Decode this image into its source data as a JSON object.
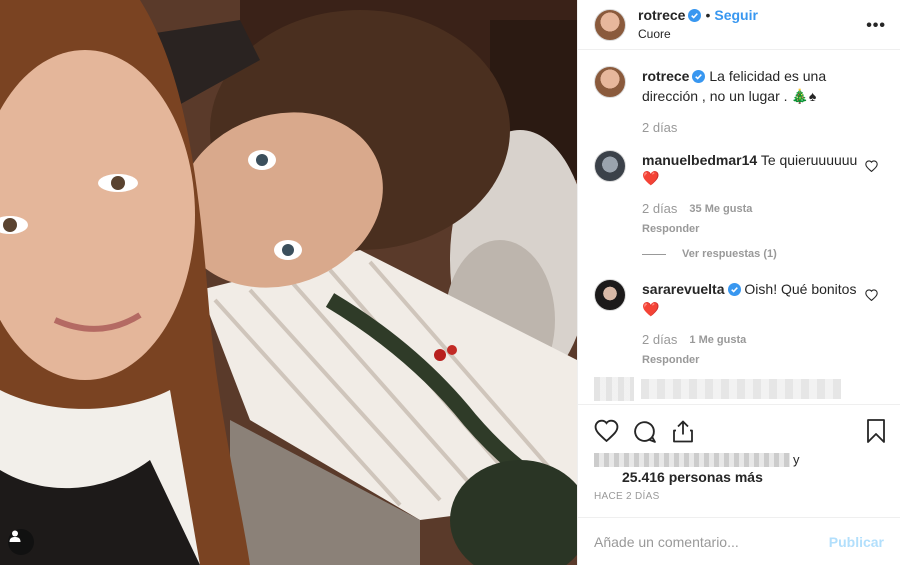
{
  "post": {
    "author": "rotrece",
    "follow_label": "Seguir",
    "location": "Cuore",
    "more_icon": "more-horizontal-icon",
    "separator": "•"
  },
  "caption": {
    "author": "rotrece",
    "text": "La felicidad es una dirección , no un lugar . 🎄♠",
    "age": "2 días"
  },
  "comments": [
    {
      "author": "manuelbedmar14",
      "text": "Te quieruuuuuu❤️",
      "age": "2 días",
      "likes": "35 Me gusta",
      "reply_label": "Responder",
      "view_replies": "Ver respuestas (1)"
    },
    {
      "author": "sararevuelta",
      "verified": true,
      "text": "Oish! Qué bonitos ❤️",
      "age": "2 días",
      "likes": "1 Me gusta",
      "reply_label": "Responder"
    }
  ],
  "likes": {
    "suffix": "y",
    "count_text": "25.416 personas más"
  },
  "time_label": "HACE 2 DÍAS",
  "add_comment": {
    "placeholder": "Añade un comentario...",
    "publish_label": "Publicar"
  },
  "colors": {
    "accent": "#3897f0",
    "verified": "#3897f0",
    "heart": "#ed4956",
    "muted": "#999999",
    "publish_disabled": "#b2dffc"
  }
}
